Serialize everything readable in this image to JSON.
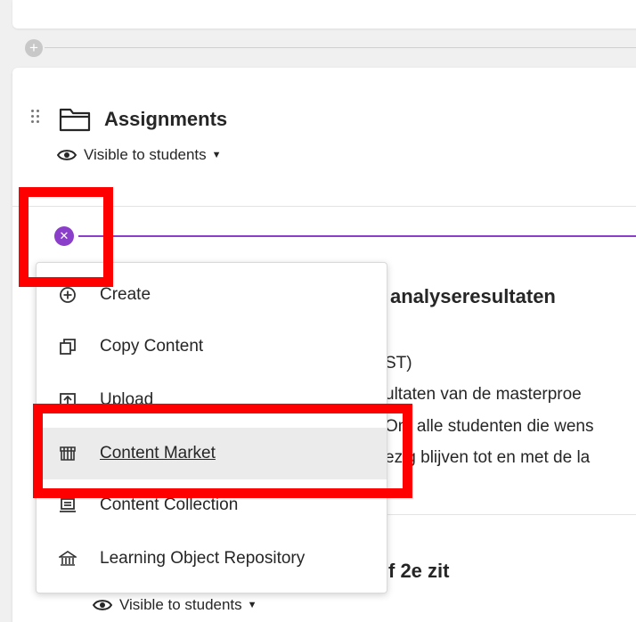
{
  "section": {
    "title": "Assignments",
    "visibility": "Visible to students"
  },
  "menu": {
    "items": [
      {
        "label": "Create",
        "icon": "plus-circle-icon"
      },
      {
        "label": "Copy Content",
        "icon": "copy-icon"
      },
      {
        "label": "Upload",
        "icon": "upload-icon"
      },
      {
        "label": "Content Market",
        "icon": "store-icon",
        "highlighted": true
      },
      {
        "label": "Content Collection",
        "icon": "collection-icon"
      },
      {
        "label": "Learning Object Repository",
        "icon": "repository-icon"
      }
    ]
  },
  "background_item": {
    "title_fragment": "analyseresultaten",
    "line1": "ST)",
    "line2": "ultaten van de masterproe",
    "line3": "Om alle studenten die wens",
    "line4": "ezig blijven tot en met de la"
  },
  "next_item": {
    "title_fragment": "f 2e zit",
    "visibility": "Visible to students"
  },
  "colors": {
    "accent": "#8a3ec9",
    "annotation": "#ff0000",
    "highlight_bg": "#ebebeb"
  }
}
